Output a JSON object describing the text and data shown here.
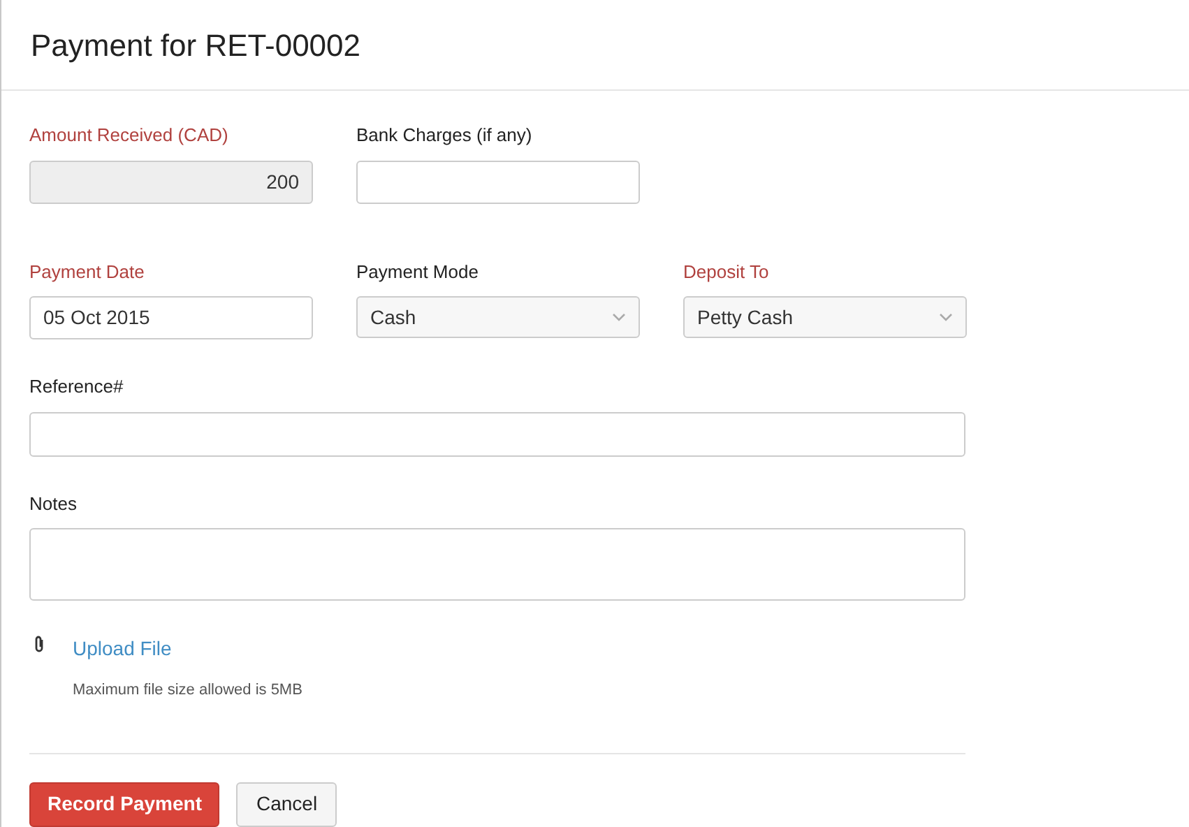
{
  "title": "Payment for RET-00002",
  "rows": [
    [
      {
        "label": "Amount Received (CAD)",
        "required": true,
        "kind": "readonly",
        "value": "200"
      },
      {
        "label": "Bank Charges (if any)",
        "required": false,
        "kind": "text"
      }
    ],
    [
      {
        "label": "Payment Date",
        "required": true,
        "kind": "text",
        "value": "05 Oct 2015"
      },
      {
        "label": "Payment Mode",
        "required": false,
        "kind": "select",
        "value": "Cash"
      },
      {
        "label": "Deposit To",
        "required": true,
        "kind": "select",
        "value": "Petty Cash"
      }
    ],
    [
      {
        "label": "Reference#",
        "required": false,
        "kind": "wide"
      }
    ],
    [
      {
        "label": "Notes",
        "required": false,
        "kind": "textarea"
      }
    ]
  ],
  "upload": {
    "link": "Upload File",
    "hint": "Maximum file size allowed is 5MB"
  },
  "buttons": [
    {
      "label": "Record Payment",
      "kind": "primary"
    },
    {
      "label": "Cancel",
      "kind": "secondary"
    }
  ]
}
